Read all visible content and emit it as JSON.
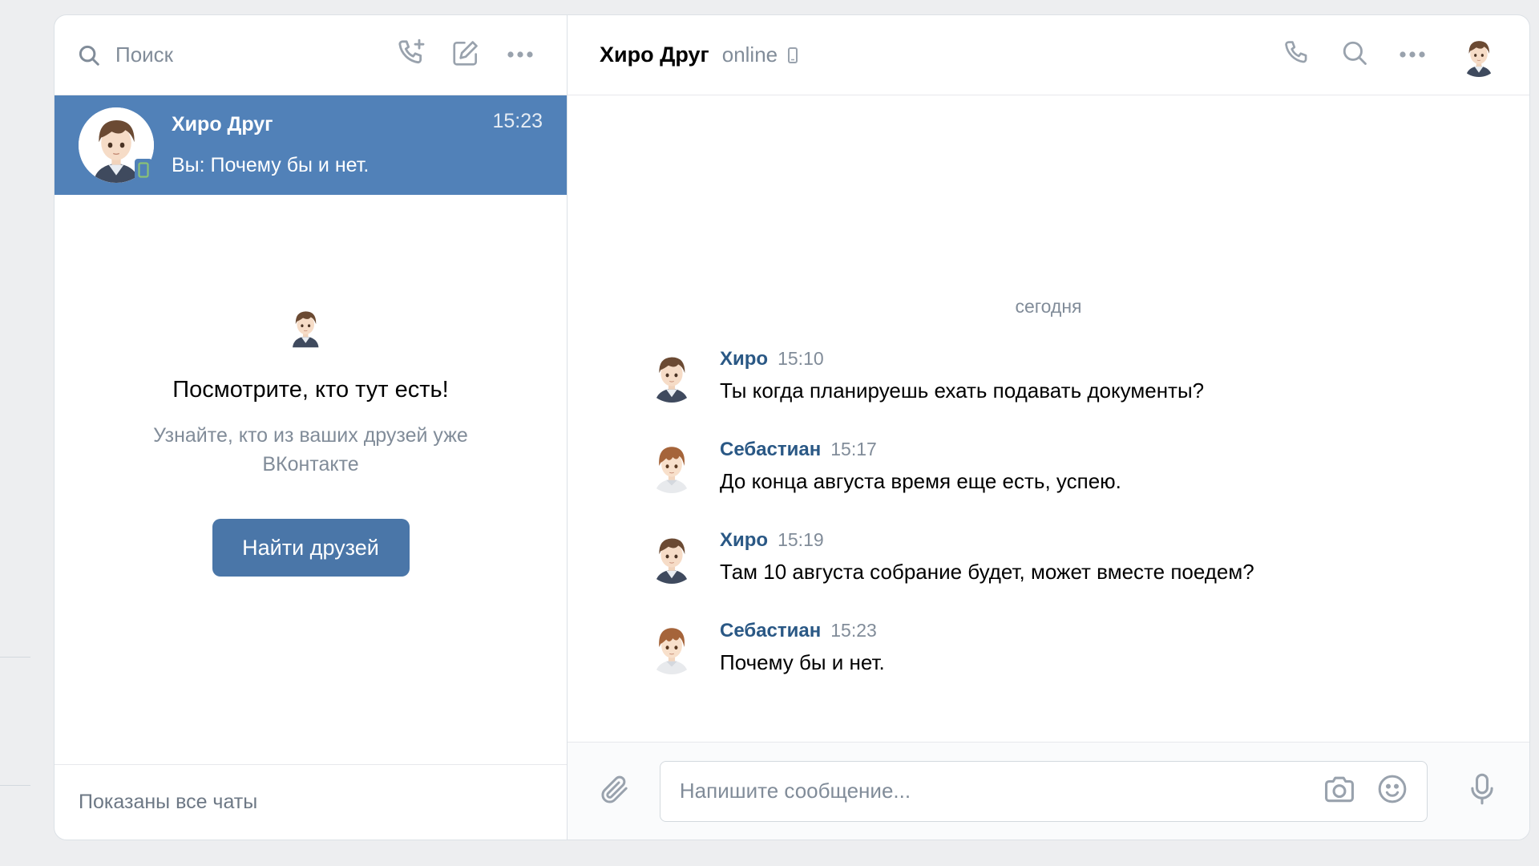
{
  "search": {
    "placeholder": "Поиск"
  },
  "chat_list": [
    {
      "name": "Хиро Друг",
      "last_message": "Вы: Почему бы и нет.",
      "time": "15:23",
      "online_mobile": true
    }
  ],
  "empty_state": {
    "title": "Посмотрите, кто тут есть!",
    "subtitle_line1": "Узнайте, кто из ваших друзей уже",
    "subtitle_line2": "ВКонтакте",
    "button_label": "Найти друзей"
  },
  "left_footer": "Показаны все чаты",
  "conversation": {
    "name": "Хиро Друг",
    "status": "online",
    "day_separator": "сегодня",
    "messages": [
      {
        "author": "Хиро",
        "time": "15:10",
        "text": "Ты когда планируешь ехать подавать документы?",
        "avatar": "hiro"
      },
      {
        "author": "Себастиан",
        "time": "15:17",
        "text": "До конца августа время еще есть, успею.",
        "avatar": "sebastian"
      },
      {
        "author": "Хиро",
        "time": "15:19",
        "text": "Там 10 августа собрание будет, может вместе поедем?",
        "avatar": "hiro"
      },
      {
        "author": "Себастиан",
        "time": "15:23",
        "text": "Почему бы и нет.",
        "avatar": "sebastian"
      }
    ]
  },
  "composer": {
    "placeholder": "Напишите сообщение..."
  },
  "colors": {
    "accent": "#5181b8",
    "button": "#4a76a8",
    "author_link": "#2a5885",
    "muted_text": "#818c99",
    "icon": "#99a2ad",
    "mobile_badge": "#8ac176"
  },
  "icons": {
    "search": "search-icon",
    "add_call": "phone-plus-icon",
    "compose": "edit-icon",
    "more": "more-horizontal-icon",
    "call": "phone-icon",
    "attach": "paperclip-icon",
    "camera": "camera-icon",
    "smile": "smile-icon",
    "mic": "microphone-icon",
    "mobile": "mobile-phone-icon"
  }
}
